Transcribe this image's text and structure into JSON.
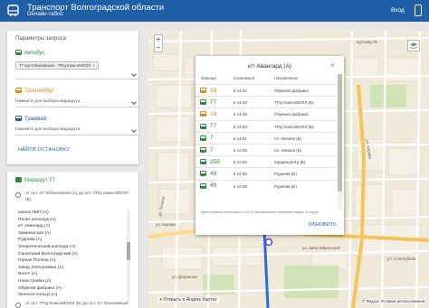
{
  "header": {
    "title": "Транспорт Волгоградской области",
    "subtitle": "Онлайн-табло",
    "login": "Вход",
    "bg_color": "#1e5fa6"
  },
  "query": {
    "title": "Параметры запроса",
    "bus_label": "Автобус",
    "bus_chip": "77 к/р Юбилейный - ТРЦ КомсоМОЛЛ",
    "troll_label": "Троллейбус",
    "troll_placeholder": "Нажмите для выбора маршрута",
    "tram_label": "Трамвай",
    "tram_placeholder": "Нажмите для выбора маршрута",
    "find_button": "НАЙТИ ОСТАНОВКУ"
  },
  "route": {
    "title": "Маршрут 77",
    "direction1": "от ост. к/т Юбилейный (А) до ост. ТРЦ КомсоМОЛЛ (Б)",
    "direction2": "от ост. ТРЦ КомсоМОЛЛ (Б) до ост. к/т Юбилейный (А)",
    "stops": [
      "школа №57 (А)",
      "Полит колледж (А)",
      "к/т Авангард (А)",
      "Заканвоская (А)",
      "Руднева (А)",
      "Энергетический колледж (А)",
      "Санаторий Волгоградский (А)",
      "Горная Поляна (А)",
      "завод Электромаш (А)",
      "ВолгУ (А)",
      "Новостройка (А)",
      "Обувная фабрика (А)",
      "Зеленое кольцо (А)"
    ]
  },
  "map": {
    "open_in": "Открыть в Яндекс.Картах",
    "terms": "© Яндекс Условия использования",
    "zoom_in": "+",
    "zoom_out": "−",
    "labels": {
      "l1": "ул. Кирова",
      "l2": "Бульвар 30",
      "l3": "ул. Ленина",
      "l4": "ул. Зины Маресевой",
      "l5": "ул. Кирова",
      "l6": "ул. Сологубова",
      "l7": "ул. Дорожная"
    }
  },
  "popup": {
    "title": "к/т Авангард (А)",
    "close": "×",
    "col_route": "Маршрут",
    "col_arrival": "Ближайший",
    "col_direction": "Направление",
    "rows": [
      {
        "type": "troll",
        "num": "18",
        "time": "в 14:42",
        "dir": "Обувная фабрика"
      },
      {
        "type": "bus",
        "num": "77",
        "time": "в 14:43",
        "dir": "ТРЦ КомсоМОЛЛ (Б)"
      },
      {
        "type": "troll",
        "num": "18",
        "time": "в 14:45",
        "dir": "Обувная фабрика"
      },
      {
        "type": "bus",
        "num": "77",
        "time": "в 14:50",
        "dir": "ТРЦ КомсоМОЛЛ (Б)"
      },
      {
        "type": "bus",
        "num": "7",
        "time": "в 14:51",
        "dir": "пл. Ленина (Б)"
      },
      {
        "type": "bus",
        "num": "7",
        "time": "в 14:55",
        "dir": "пл. Ленина (Б)"
      },
      {
        "type": "bus",
        "num": "259",
        "time": "в 14:55",
        "dir": "Кардиоцентр (Б)"
      },
      {
        "type": "bus",
        "num": "49",
        "time": "в 14:56",
        "dir": "Руднева (Б)"
      },
      {
        "type": "bus",
        "num": "49",
        "time": "в 14:59",
        "dir": "Руднева (Б)"
      }
    ],
    "note": "Время прибытия транспорта в 14:27:40 Автоматическое обновление каждые 30 секунд",
    "update_button": "ОБНОВИТЬ"
  },
  "colors": {
    "bus": "#2e8b3d",
    "troll": "#e08a0b",
    "tram": "#1e5fa6"
  }
}
